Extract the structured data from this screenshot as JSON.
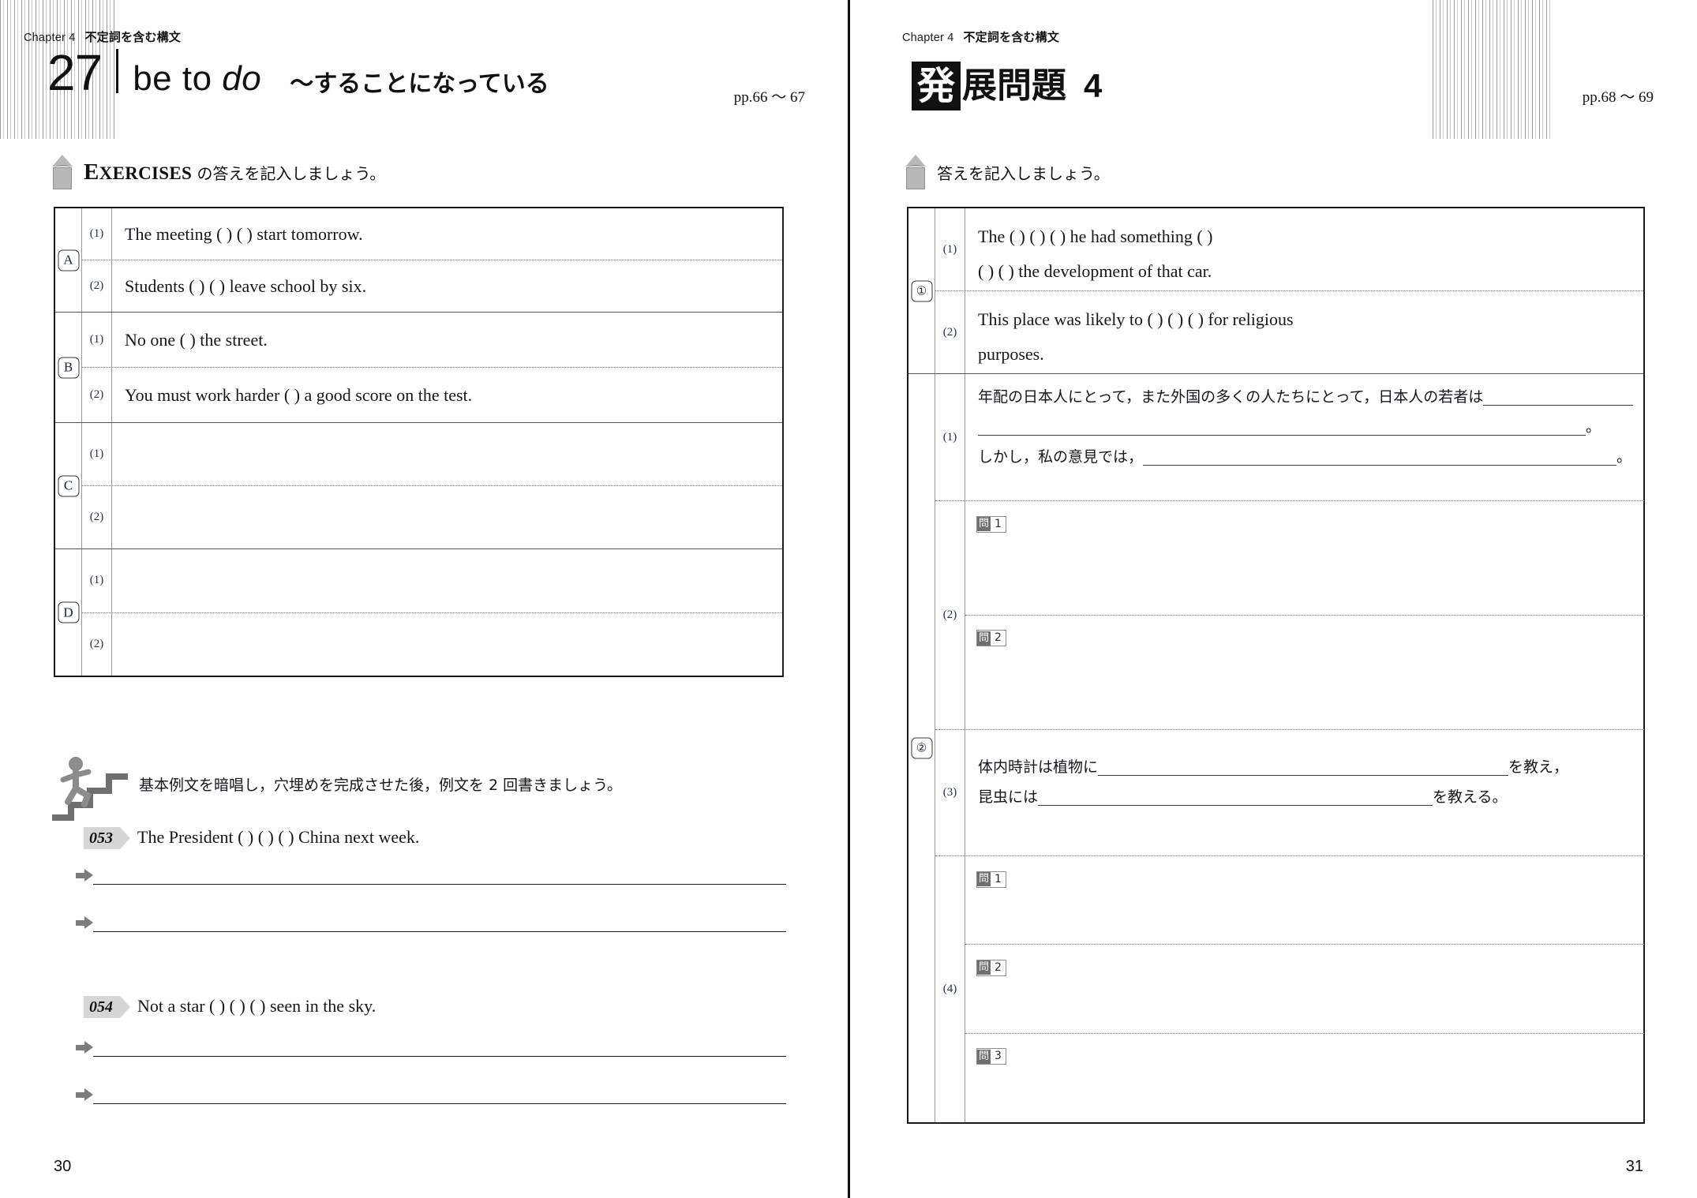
{
  "spread": {
    "left_page_number": "30",
    "right_page_number": "31"
  },
  "left_page": {
    "chapter_label": "Chapter 4",
    "chapter_title": "不定詞を含む構文",
    "section_number": "27",
    "section_title_en": "be to do",
    "section_title_jp": "〜することになっている",
    "page_ref": "pp.66 〜 67",
    "prompt": {
      "icon": "pencil-icon",
      "caps_first": "E",
      "caps_rest": "XERCISES",
      "text": "の答えを記入しましょう。"
    },
    "exercise_groups": [
      {
        "letter": "A",
        "rows": [
          {
            "num": "(1)",
            "text": "The meeting (              ) (              ) start tomorrow."
          },
          {
            "num": "(2)",
            "text": "Students (              ) (              ) leave school by six."
          }
        ]
      },
      {
        "letter": "B",
        "rows": [
          {
            "num": "(1)",
            "text": "No one (                                                    ) the street."
          },
          {
            "num": "(2)",
            "text": "You must work harder (                              ) a good score on the test."
          }
        ]
      },
      {
        "letter": "C",
        "rows": [
          {
            "num": "(1)",
            "text": ""
          },
          {
            "num": "(2)",
            "text": ""
          }
        ]
      },
      {
        "letter": "D",
        "rows": [
          {
            "num": "(1)",
            "text": ""
          },
          {
            "num": "(2)",
            "text": ""
          }
        ]
      }
    ],
    "practice": {
      "icon": "runner-on-stairs-icon",
      "instruction": "基本例文を暗唱し，穴埋めを完成させた後，例文を 2 回書きましょう。",
      "items": [
        {
          "badge": "053",
          "sentence": "The President (              ) (              ) (              ) China next week.",
          "write_lines": 2
        },
        {
          "badge": "054",
          "sentence": "Not a star (              ) (              ) (              ) seen in the sky.",
          "write_lines": 2
        }
      ]
    }
  },
  "right_page": {
    "chapter_label": "Chapter 4",
    "chapter_title": "不定詞を含む構文",
    "title_badge": "発",
    "title_text": "展問題",
    "title_number": "4",
    "page_ref": "pp.68 〜 69",
    "prompt": {
      "icon": "pencil-icon",
      "text": "答えを記入しましょう。"
    },
    "groups": [
      {
        "number": "①",
        "rows": [
          {
            "num": "(1)",
            "lines": [
              "The (              ) (              ) (              ) he had something (              )",
              "(              ) (              ) the development of that car."
            ]
          },
          {
            "num": "(2)",
            "lines": [
              "This   place   was   likely   to   (              )   (              )   (              )   for   religious",
              "purposes."
            ]
          }
        ]
      },
      {
        "number": "②",
        "rows": [
          {
            "num": "(1)",
            "kind": "jp-blanks",
            "lines": [
              "年配の日本人にとって，また外国の多くの人たちにとって，日本人の若者は",
              "。",
              "しかし，私の意見では，",
              "。"
            ]
          },
          {
            "num": "(2)",
            "kind": "sub-questions",
            "sub": [
              {
                "kanji": "問",
                "n": "1"
              },
              {
                "kanji": "問",
                "n": "2"
              }
            ]
          },
          {
            "num": "(3)",
            "kind": "jp-blanks",
            "lines": [
              "体内時計は植物に",
              "を教え，",
              "昆虫には",
              "を教える。"
            ]
          },
          {
            "num": "(4)",
            "kind": "sub-questions",
            "sub": [
              {
                "kanji": "問",
                "n": "1"
              },
              {
                "kanji": "問",
                "n": "2"
              },
              {
                "kanji": "問",
                "n": "3"
              }
            ]
          }
        ]
      }
    ]
  }
}
